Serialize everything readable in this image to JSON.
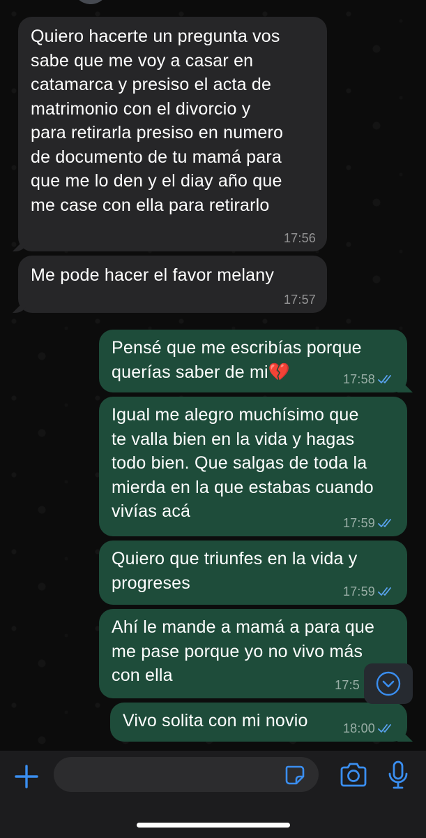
{
  "messages": [
    {
      "direction": "incoming",
      "text": "Quiero hacerte un pregunta vos\nsabe que me voy a casar en\ncatamarca  y presiso el acta de\nmatrimonio con el divorcio  y\npara retirarla  presiso en numero\nde documento de tu mamá  para\nque me lo den y el diay año que\nme case con ella para retirarlo",
      "time": "17:56"
    },
    {
      "direction": "incoming",
      "text": "Me pode hacer el favor melany",
      "time": "17:57"
    },
    {
      "direction": "outgoing",
      "text": "Pensé que me escribías porque\nquerías saber de mi💔",
      "time": "17:58"
    },
    {
      "direction": "outgoing",
      "text": "Igual me alegro muchísimo que\nte valla bien en la vida y hagas\ntodo bien. Que salgas de toda la\nmierda en la que estabas cuando\nvivías acá",
      "time": "17:59"
    },
    {
      "direction": "outgoing",
      "text": "Quiero que triunfes en la vida y\nprogreses",
      "time": "17:59"
    },
    {
      "direction": "outgoing",
      "text": "Ahí le mande a mamá a para que\nme pase porque yo no vivo más\ncon ella",
      "time": "17:5"
    },
    {
      "direction": "outgoing",
      "text": "Vivo solita con mi novio",
      "time": "18:00"
    }
  ],
  "input": {
    "placeholder": ""
  },
  "icons": {
    "attach": "plus-icon",
    "sticker": "sticker-icon",
    "camera": "camera-icon",
    "mic": "microphone-icon",
    "scroll": "chevron-down-icon",
    "read": "double-check-icon"
  },
  "colors": {
    "incoming_bubble": "#262628",
    "outgoing_bubble": "#1e4c3a",
    "accent": "#3a8ef0",
    "read_ticks": "#5aa3f0"
  }
}
